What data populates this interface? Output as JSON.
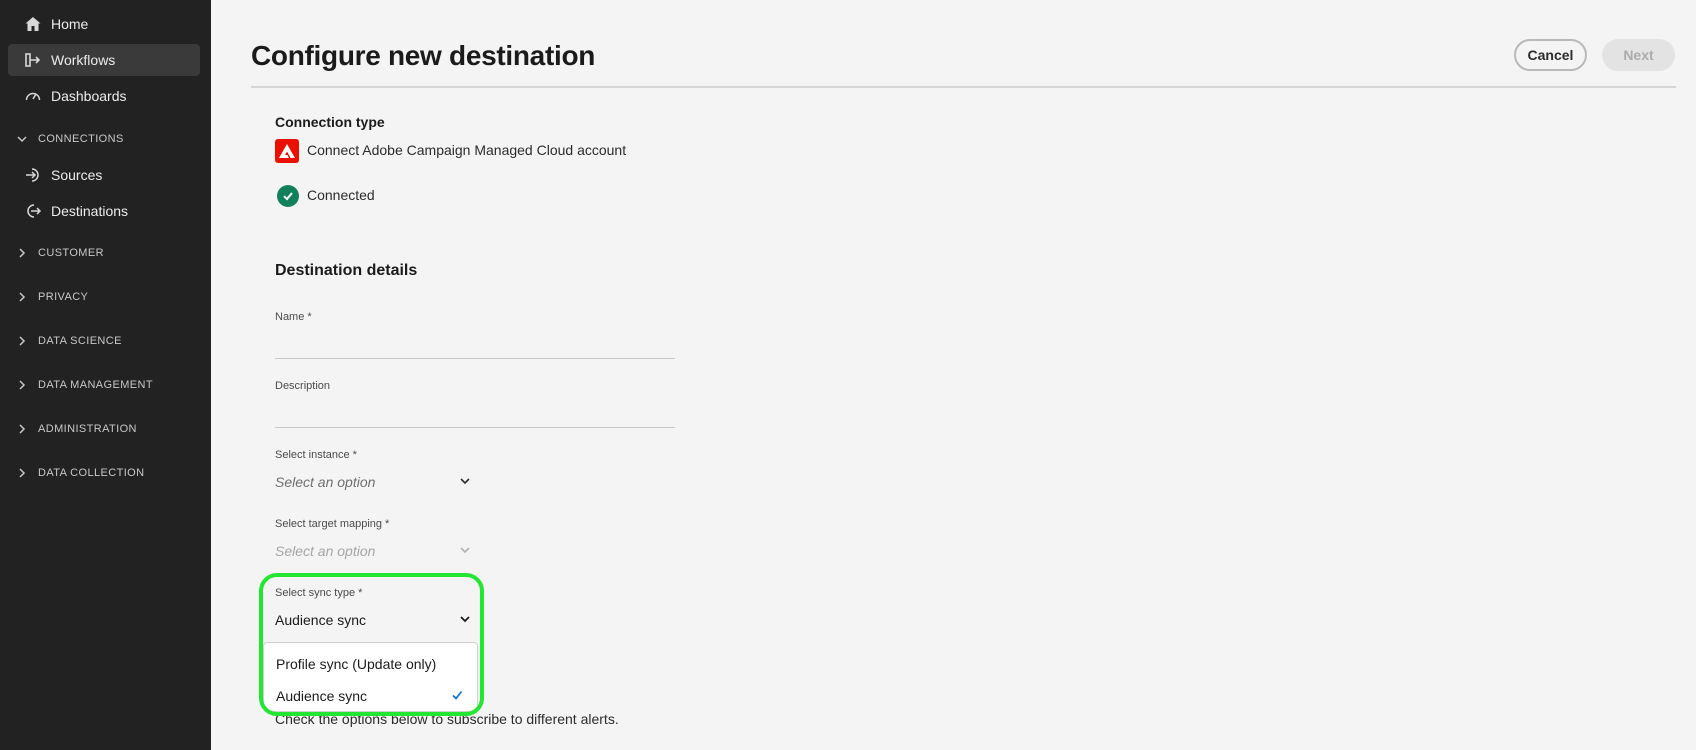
{
  "sidebar": {
    "nav": [
      {
        "label": "Home",
        "icon": "home-icon"
      },
      {
        "label": "Workflows",
        "icon": "workflows-icon",
        "active": true
      },
      {
        "label": "Dashboards",
        "icon": "dashboards-icon"
      }
    ],
    "sections": {
      "connections": "CONNECTIONS",
      "customer": "CUSTOMER",
      "privacy": "PRIVACY",
      "data_science": "DATA SCIENCE",
      "data_management": "DATA MANAGEMENT",
      "administration": "ADMINISTRATION",
      "data_collection": "DATA COLLECTION"
    },
    "connection_items": [
      {
        "label": "Sources",
        "icon": "sources-icon"
      },
      {
        "label": "Destinations",
        "icon": "destinations-icon"
      }
    ]
  },
  "header": {
    "title": "Configure new destination",
    "cancel_label": "Cancel",
    "next_label": "Next"
  },
  "connection": {
    "heading": "Connection type",
    "account_label": "Connect Adobe Campaign Managed Cloud account",
    "status": "Connected"
  },
  "details": {
    "heading": "Destination details",
    "name_label": "Name",
    "name_value": "",
    "description_label": "Description",
    "description_value": "",
    "instance_label": "Select instance",
    "instance_placeholder": "Select an option",
    "mapping_label": "Select target mapping",
    "mapping_placeholder": "Select an option",
    "sync_label": "Select sync type",
    "sync_value": "Audience sync",
    "sync_options": [
      {
        "label": "Profile sync (Update only)",
        "selected": false
      },
      {
        "label": "Audience sync",
        "selected": true
      }
    ],
    "required_mark": "*"
  },
  "alerts": {
    "hint": "Check the options below to subscribe to different alerts."
  },
  "colors": {
    "sidebar_bg": "#222222",
    "adobe_red": "#eb1000",
    "success_green": "#12805c",
    "highlight_green": "#22e632",
    "check_blue": "#1473e6"
  }
}
